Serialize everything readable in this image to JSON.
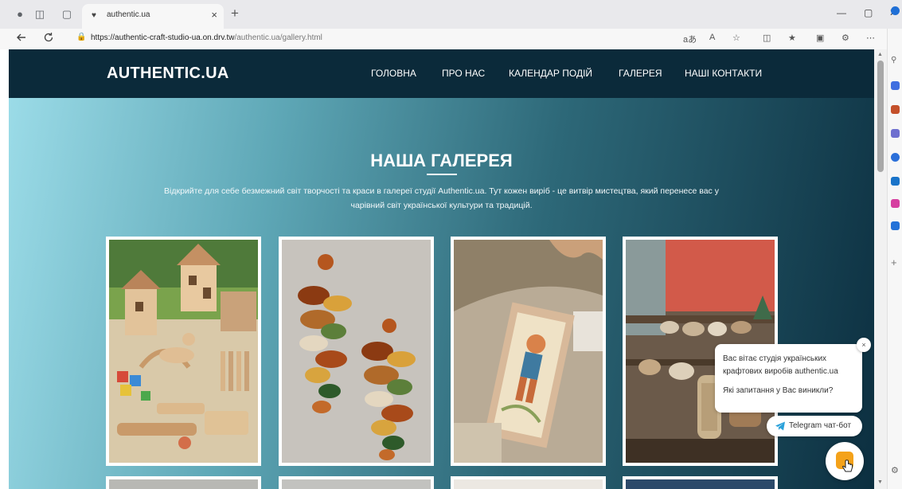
{
  "browser": {
    "tab_title": "authentic.ua",
    "tab_close": "×",
    "new_tab": "+",
    "url_host": "https://authentic-craft-studio-ua.on.drv.tw",
    "url_path": "/authentic.ua/gallery.html",
    "minimize": "—",
    "restore": "▢",
    "close": "✕"
  },
  "site": {
    "logo": "AUTHENTIC.UA",
    "nav": [
      "ГОЛОВНА",
      "ПРО НАС",
      "КАЛЕНДАР ПОДІЙ",
      "ГАЛЕРЕЯ",
      "НАШІ КОНТАКТИ"
    ]
  },
  "gallery": {
    "title": "НАША ГАЛЕРЕЯ",
    "intro_line1": "Відкрийте для себе безмежний світ творчості та краси в галереї студії Authentic.ua. Тут кожен виріб - це витвір мистецтва, який перенесе вас у",
    "intro_line2": "чарівний світ української культури та традицій."
  },
  "chat": {
    "greeting_line1": "Вас вітає студія українських",
    "greeting_line2": "крафтових виробів authentic.ua",
    "question": "Які запитання у Вас виникли?",
    "telegram_label": "Telegram чат-бот",
    "close_symbol": "×"
  },
  "icons": {
    "back": "arrow-left-icon",
    "refresh": "refresh-icon",
    "lock": "lock-icon",
    "telegram": "telegram-icon"
  },
  "colors": {
    "header_bg": "#0b2a3a",
    "fab_accent": "#f4a21a",
    "telegram": "#2aa1da"
  }
}
